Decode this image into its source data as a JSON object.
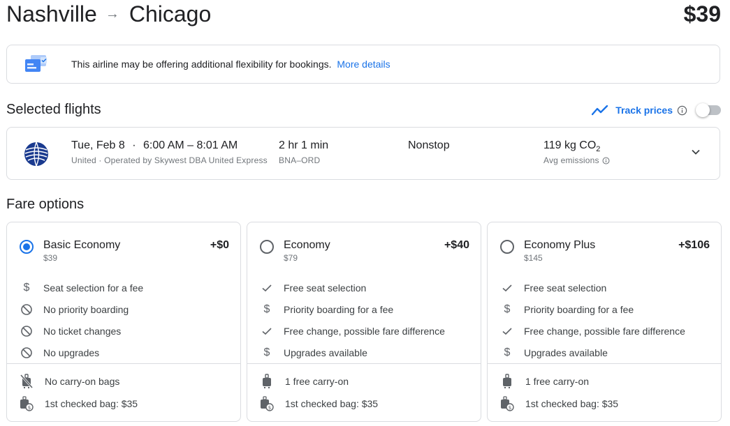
{
  "header": {
    "origin": "Nashville",
    "arrow": "→",
    "destination": "Chicago",
    "total_price": "$39"
  },
  "banner": {
    "icon": "flexible-booking-icon",
    "text": "This airline may be offering additional flexibility for bookings.",
    "link": "More details"
  },
  "selected_flights": {
    "title": "Selected flights",
    "track_prices": {
      "label": "Track prices",
      "icon": "trend-line-icon",
      "enabled": false
    },
    "flight": {
      "airline_logo": "united-logo-icon",
      "date": "Tue, Feb 8",
      "separator": "·",
      "times": "6:00 AM – 8:01 AM",
      "airline_detail": "United · Operated by Skywest DBA United Express",
      "duration": "2 hr 1 min",
      "route_code": "BNA–ORD",
      "stops": "Nonstop",
      "emissions_value": "119 kg CO",
      "emissions_sub": "2",
      "emissions_label": "Avg emissions",
      "expand_icon": "chevron-down-icon"
    }
  },
  "fare_options": {
    "title": "Fare options",
    "fares": [
      {
        "name": "Basic Economy",
        "base_price": "$39",
        "price_diff": "+$0",
        "selected": true,
        "features": [
          {
            "icon": "dollar-icon",
            "text": "Seat selection for a fee"
          },
          {
            "icon": "prohibited-icon",
            "text": "No priority boarding"
          },
          {
            "icon": "prohibited-icon",
            "text": "No ticket changes"
          },
          {
            "icon": "prohibited-icon",
            "text": "No upgrades"
          }
        ],
        "bags": [
          {
            "icon": "no-carry-on-icon",
            "text": "No carry-on bags"
          },
          {
            "icon": "checked-bag-fee-icon",
            "text": "1st checked bag: $35"
          }
        ]
      },
      {
        "name": "Economy",
        "base_price": "$79",
        "price_diff": "+$40",
        "selected": false,
        "features": [
          {
            "icon": "check-icon",
            "text": "Free seat selection"
          },
          {
            "icon": "dollar-icon",
            "text": "Priority boarding for a fee"
          },
          {
            "icon": "check-icon",
            "text": "Free change, possible fare difference"
          },
          {
            "icon": "dollar-icon",
            "text": "Upgrades available"
          }
        ],
        "bags": [
          {
            "icon": "carry-on-icon",
            "text": "1 free carry-on"
          },
          {
            "icon": "checked-bag-fee-icon",
            "text": "1st checked bag: $35"
          }
        ]
      },
      {
        "name": "Economy Plus",
        "base_price": "$145",
        "price_diff": "+$106",
        "selected": false,
        "features": [
          {
            "icon": "check-icon",
            "text": "Free seat selection"
          },
          {
            "icon": "dollar-icon",
            "text": "Priority boarding for a fee"
          },
          {
            "icon": "check-icon",
            "text": "Free change, possible fare difference"
          },
          {
            "icon": "dollar-icon",
            "text": "Upgrades available"
          }
        ],
        "bags": [
          {
            "icon": "carry-on-icon",
            "text": "1 free carry-on"
          },
          {
            "icon": "checked-bag-fee-icon",
            "text": "1st checked bag: $35"
          }
        ]
      }
    ]
  },
  "colors": {
    "accent": "#1a73e8",
    "text": "#202124",
    "muted": "#70757a",
    "border": "#dadce0"
  }
}
